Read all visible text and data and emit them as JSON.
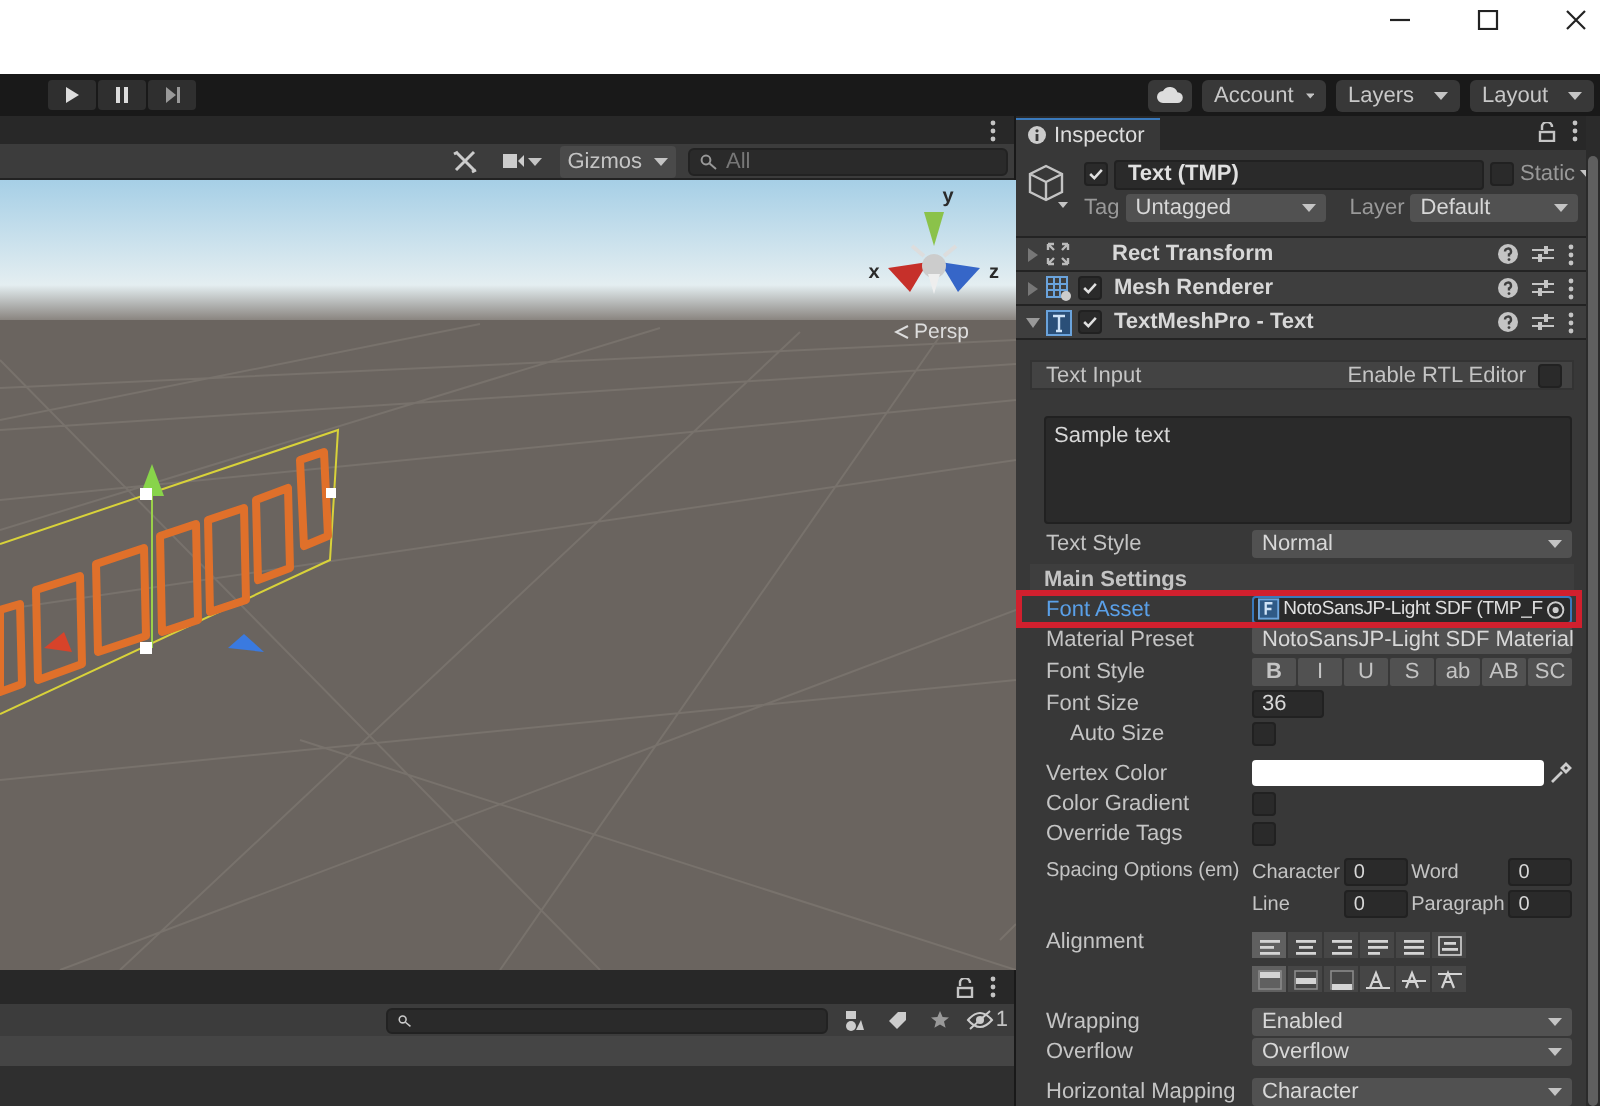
{
  "toolbar": {
    "menus": [
      "Account",
      "Layers",
      "Layout"
    ]
  },
  "scene": {
    "gizmos_label": "Gizmos",
    "search_placeholder": "All",
    "camera_label": "Persp",
    "axis_labels": [
      "y",
      "x",
      "z"
    ]
  },
  "inspector": {
    "tab": "Inspector",
    "object": {
      "active": true,
      "name": "Text (TMP)",
      "static": false,
      "static_label": "Static",
      "tag_label": "Tag",
      "tag": "Untagged",
      "layer_label": "Layer",
      "layer": "Default"
    },
    "components": [
      {
        "name": "Rect Transform",
        "kind": "transform",
        "expanded": false
      },
      {
        "name": "Mesh Renderer",
        "kind": "mesh_renderer",
        "expanded": false,
        "enabled": true
      },
      {
        "name": "TextMeshPro - Text",
        "kind": "text_mesh_pro",
        "expanded": true,
        "enabled": true
      }
    ],
    "text_input": {
      "title": "Text Input",
      "rtl_label": "Enable RTL Editor",
      "rtl_enabled": false,
      "text": "Sample text",
      "style_label": "Text Style",
      "style": "Normal"
    },
    "main_settings": {
      "title": "Main Settings",
      "groups": [
        [
          {
            "kind": "object",
            "label": "Font Asset",
            "value": "NotoSansJP-Light SDF (TMP_F",
            "highlighted": true
          },
          {
            "kind": "dropdown",
            "label": "Material Preset",
            "value": "NotoSansJP-Light SDF Material"
          },
          {
            "kind": "toggles",
            "label": "Font Style",
            "options": [
              {
                "label": "B",
                "selected": false
              },
              {
                "label": "I",
                "selected": false
              },
              {
                "label": "U",
                "selected": false
              },
              {
                "label": "S",
                "selected": false
              },
              {
                "label": "ab",
                "selected": false
              },
              {
                "label": "AB",
                "selected": false
              },
              {
                "label": "SC",
                "selected": false
              }
            ]
          },
          {
            "kind": "number",
            "label": "Font Size",
            "value": "36",
            "children": [
              {
                "kind": "checkbox",
                "label": "Auto Size",
                "checked": false
              }
            ]
          }
        ],
        [
          {
            "kind": "color",
            "label": "Vertex Color",
            "color": "#ffffff"
          },
          {
            "kind": "checkbox",
            "label": "Color Gradient",
            "checked": false
          },
          {
            "kind": "checkbox",
            "label": "Override Tags",
            "checked": false
          }
        ],
        [
          {
            "kind": "spacing",
            "label": "Spacing Options (em)",
            "entries": [
              {
                "label": "Character",
                "value": "0"
              },
              {
                "label": "Word",
                "value": "0"
              },
              {
                "label": "Line",
                "value": "0"
              },
              {
                "label": "Paragraph",
                "value": "0"
              }
            ]
          }
        ],
        [
          {
            "kind": "alignment",
            "label": "Alignment",
            "rows": [
              [
                {
                  "kind": "left",
                  "selected": true
                },
                {
                  "kind": "center",
                  "selected": false
                },
                {
                  "kind": "right",
                  "selected": false
                },
                {
                  "kind": "justified",
                  "selected": false
                },
                {
                  "kind": "flush",
                  "selected": false
                },
                {
                  "kind": "geometry",
                  "selected": false
                }
              ],
              [
                {
                  "kind": "top",
                  "selected": true
                },
                {
                  "kind": "middle",
                  "selected": false
                },
                {
                  "kind": "bottom",
                  "selected": false
                },
                {
                  "kind": "baseline",
                  "selected": false
                },
                {
                  "kind": "midline",
                  "selected": false
                },
                {
                  "kind": "capline",
                  "selected": false
                }
              ]
            ]
          }
        ],
        [
          {
            "kind": "dropdown",
            "label": "Wrapping",
            "value": "Enabled"
          },
          {
            "kind": "dropdown",
            "label": "Overflow",
            "value": "Overflow"
          }
        ],
        [
          {
            "kind": "dropdown",
            "label": "Horizontal Mapping",
            "value": "Character"
          }
        ]
      ]
    }
  },
  "project_panel": {
    "hidden_count": "1"
  }
}
